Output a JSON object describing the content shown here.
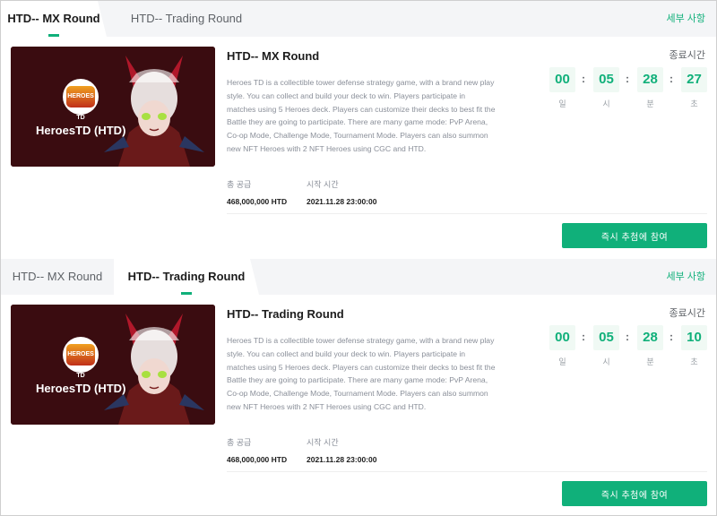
{
  "accent": "#10b07a",
  "rounds": [
    {
      "tabs": [
        "HTD-- MX Round",
        "HTD-- Trading Round"
      ],
      "active_tab": 0,
      "details_link": "세부 사항",
      "banner_name": "HeroesTD (HTD)",
      "logo_text": "HEROES TD",
      "title": "HTD-- MX Round",
      "description": "Heroes TD is a collectible tower defense strategy game, with a brand new play style. You can collect and build your deck to win. Players participate in matches using 5 Heroes deck. Players can customize their decks to best fit the Battle they are going to participate. There are many game mode: PvP Arena, Co-op Mode, Challenge Mode, Tournament Mode. Players can also summon new NFT Heroes with 2 NFT Heroes using CGC and HTD.",
      "supply_label": "총 공급",
      "supply_value": "468,000,000 HTD",
      "start_label": "시작 시간",
      "start_value": "2021.11.28 23:00:00",
      "timer_label": "종료시간",
      "timer": {
        "d": "00",
        "h": "05",
        "m": "28",
        "s": "27"
      },
      "timer_units": {
        "d": "일",
        "h": "시",
        "m": "분",
        "s": "초"
      },
      "join_button": "즉시 추첨에 참여"
    },
    {
      "tabs": [
        "HTD-- MX Round",
        "HTD-- Trading Round"
      ],
      "active_tab": 1,
      "details_link": "세부 사항",
      "banner_name": "HeroesTD (HTD)",
      "logo_text": "HEROES TD",
      "title": "HTD-- Trading Round",
      "description": "Heroes TD is a collectible tower defense strategy game, with a brand new play style. You can collect and build your deck to win. Players participate in matches using 5 Heroes deck. Players can customize their decks to best fit the Battle they are going to participate. There are many game mode: PvP Arena, Co-op Mode, Challenge Mode, Tournament Mode. Players can also summon new NFT Heroes with 2 NFT Heroes using CGC and HTD.",
      "supply_label": "총 공급",
      "supply_value": "468,000,000 HTD",
      "start_label": "시작 시간",
      "start_value": "2021.11.28 23:00:00",
      "timer_label": "종료시간",
      "timer": {
        "d": "00",
        "h": "05",
        "m": "28",
        "s": "10"
      },
      "timer_units": {
        "d": "일",
        "h": "시",
        "m": "분",
        "s": "초"
      },
      "join_button": "즉시 추첨에 참여"
    }
  ]
}
